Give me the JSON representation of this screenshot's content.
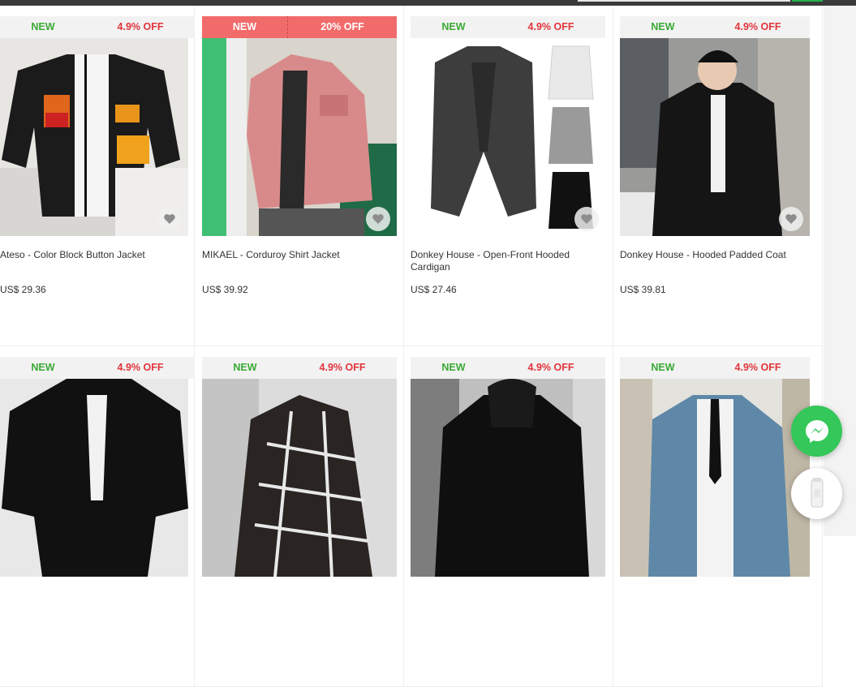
{
  "products": [
    {
      "new": "NEW",
      "off": "4.9% OFF",
      "title": "Ateso - Color Block Button Jacket",
      "price": "US$ 29.36"
    },
    {
      "new": "NEW",
      "off": "20% OFF",
      "title": "MIKAEL - Corduroy Shirt Jacket",
      "price": "US$ 39.92"
    },
    {
      "new": "NEW",
      "off": "4.9% OFF",
      "title": "Donkey House - Open-Front Hooded Cardigan",
      "price": "US$ 27.46"
    },
    {
      "new": "NEW",
      "off": "4.9% OFF",
      "title": "Donkey House - Hooded Padded Coat",
      "price": "US$ 39.81"
    },
    {
      "new": "NEW",
      "off": "4.9% OFF"
    },
    {
      "new": "NEW",
      "off": "4.9% OFF"
    },
    {
      "new": "NEW",
      "off": "4.9% OFF"
    },
    {
      "new": "NEW",
      "off": "4.9% OFF"
    }
  ],
  "icons": {
    "wishlist": "heart-icon",
    "chat": "messenger-icon",
    "recent": "product-thumbnail"
  },
  "colors": {
    "new_badge": "#3aaa35",
    "off_badge": "#e2343c",
    "hot_badge_bg": "#f16b6b",
    "messenger": "#34c759"
  }
}
